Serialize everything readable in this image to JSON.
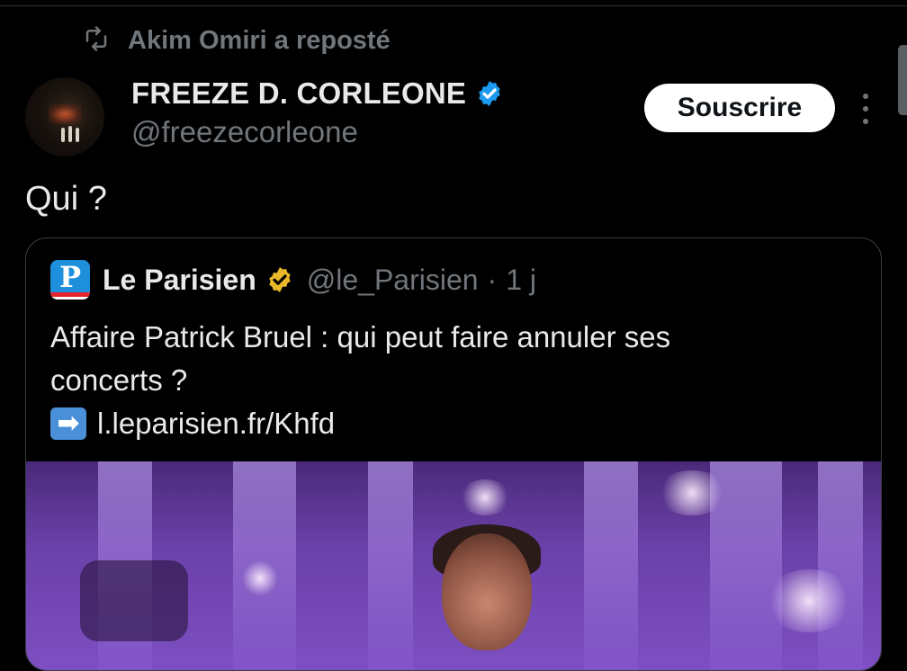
{
  "repost": {
    "icon": "repost-icon",
    "text": "Akim Omiri a reposté"
  },
  "tweet": {
    "author": {
      "display_name": "FREEZE D. CORLEONE",
      "handle": "@freezecorleone",
      "verified": true,
      "verified_color": "#1d9bf0"
    },
    "subscribe_label": "Souscrire",
    "text": "Qui ?",
    "quote": {
      "author": {
        "display_name": "Le Parisien",
        "handle": "@le_Parisien",
        "separator": "·",
        "time": "1 j",
        "logo_letter": "P",
        "verified_color": "#e8b829"
      },
      "text_line1": "Affaire Patrick Bruel : qui peut faire annuler ses",
      "text_line2": "concerts ?",
      "link_arrow": "➡",
      "link": "l.leparisien.fr/Khfd"
    }
  },
  "colors": {
    "background": "#000000",
    "text_primary": "#e7e9ea",
    "text_secondary": "#71767b",
    "border": "#3a3f44"
  }
}
